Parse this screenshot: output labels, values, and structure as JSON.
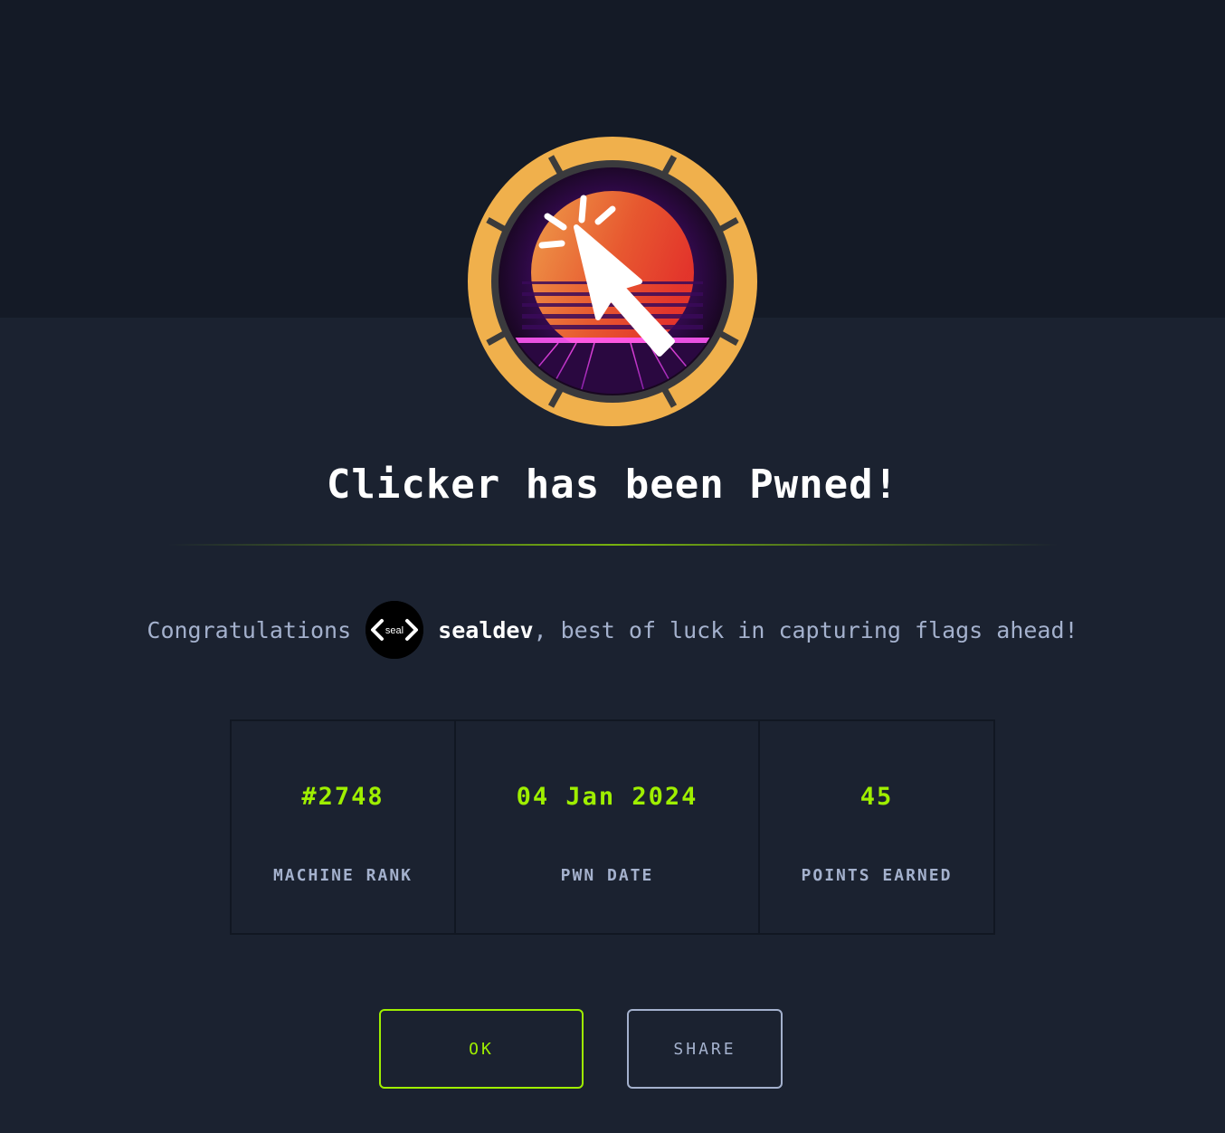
{
  "machine": {
    "name": "Clicker",
    "badge_icon": "cursor-click-icon"
  },
  "title": "Clicker has been Pwned!",
  "congrats": {
    "prefix": "Congratulations",
    "avatar_text": "seal",
    "username": "sealdev",
    "suffix": ", best of luck in capturing flags ahead!"
  },
  "stats": [
    {
      "value": "#2748",
      "label": "MACHINE RANK"
    },
    {
      "value": "04 Jan 2024",
      "label": "PWN DATE"
    },
    {
      "value": "45",
      "label": "POINTS EARNED"
    }
  ],
  "buttons": {
    "ok_label": "OK",
    "share_label": "SHARE"
  },
  "colors": {
    "accent": "#9fef00",
    "background": "#1b2230",
    "top_band": "#141a26",
    "muted_text": "#a4b1cd",
    "badge_ring": "#f0b04c"
  }
}
